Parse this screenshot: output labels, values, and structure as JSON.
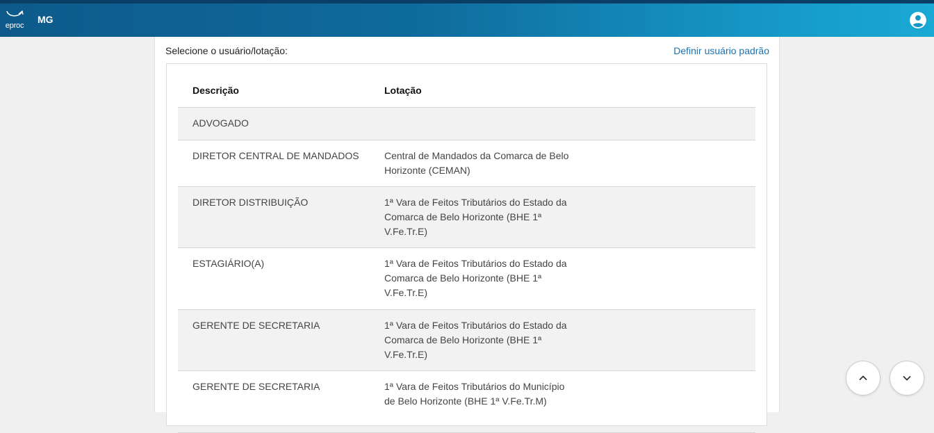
{
  "header": {
    "logo_text": "eproc",
    "state": "MG"
  },
  "panel": {
    "select_label": "Selecione o usuário/lotação:",
    "define_default_link": "Definir usuário padrão",
    "table": {
      "columns": [
        "Descrição",
        "Lotação"
      ],
      "rows": [
        {
          "descricao": "ADVOGADO",
          "lotacao": ""
        },
        {
          "descricao": "DIRETOR CENTRAL DE MANDADOS",
          "lotacao": "Central de Mandados da Comarca de Belo Horizonte (CEMAN)"
        },
        {
          "descricao": "DIRETOR DISTRIBUIÇÃO",
          "lotacao": "1ª Vara de Feitos Tributários do Estado da Comarca de Belo Horizonte (BHE 1ª V.Fe.Tr.E)"
        },
        {
          "descricao": "ESTAGIÁRIO(A)",
          "lotacao": "1ª Vara de Feitos Tributários do Estado da Comarca de Belo Horizonte (BHE 1ª V.Fe.Tr.E)"
        },
        {
          "descricao": "GERENTE DE SECRETARIA",
          "lotacao": "1ª Vara de Feitos Tributários do Estado da Comarca de Belo Horizonte (BHE 1ª V.Fe.Tr.E)"
        },
        {
          "descricao": "GERENTE DE SECRETARIA",
          "lotacao": "1ª Vara de Feitos Tributários do Município de Belo Horizonte (BHE 1ª V.Fe.Tr.M)"
        }
      ]
    }
  },
  "icons": {
    "user": "account-circle-icon",
    "scroll_up": "chevron-up-icon",
    "scroll_down": "chevron-down-icon"
  },
  "colors": {
    "header_start": "#0d5a8a",
    "header_end": "#1aa9d4",
    "link": "#1a73b0",
    "row_alt": "#f2f2f2"
  }
}
